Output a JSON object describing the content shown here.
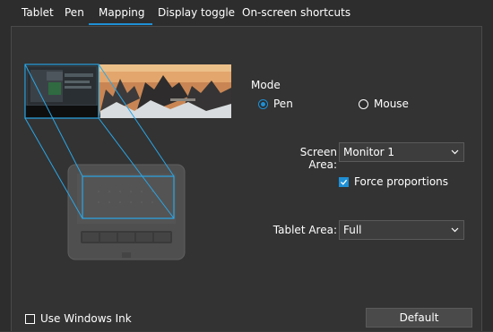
{
  "tabs": [
    {
      "label": "Tablet",
      "active": false
    },
    {
      "label": "Pen",
      "active": false
    },
    {
      "label": "Mapping",
      "active": true
    },
    {
      "label": "Display toggle",
      "active": false
    },
    {
      "label": "On-screen shortcuts",
      "active": false
    }
  ],
  "mode": {
    "label": "Mode",
    "options": [
      {
        "label": "Pen",
        "selected": true
      },
      {
        "label": "Mouse",
        "selected": false
      }
    ]
  },
  "screen_area": {
    "label": "Screen Area:",
    "value": "Monitor 1"
  },
  "force_proportions": {
    "label": "Force proportions",
    "checked": true
  },
  "tablet_area": {
    "label": "Tablet Area:",
    "value": "Full"
  },
  "use_windows_ink": {
    "label": "Use Windows Ink",
    "checked": false
  },
  "default_button": {
    "label": "Default"
  },
  "colors": {
    "accent": "#1e90d6",
    "panel": "#333333",
    "window": "#2d2d2d"
  }
}
